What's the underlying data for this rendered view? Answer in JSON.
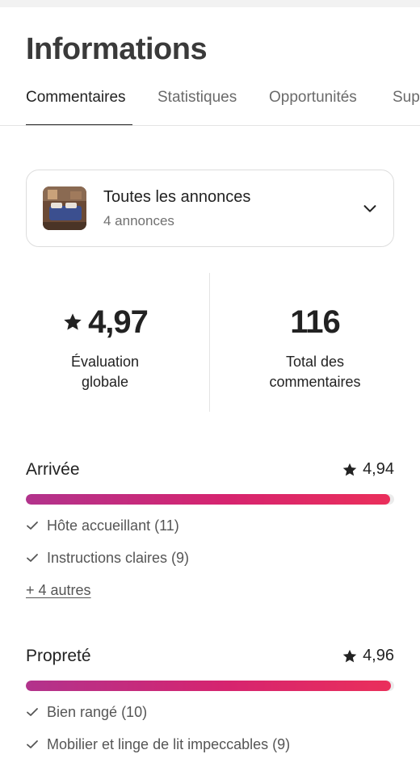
{
  "header": {
    "title": "Informations"
  },
  "tabs": [
    {
      "label": "Commentaires",
      "active": true
    },
    {
      "label": "Statistiques",
      "active": false
    },
    {
      "label": "Opportunités",
      "active": false
    },
    {
      "label": "Sup",
      "active": false
    }
  ],
  "listing": {
    "title": "Toutes les annonces",
    "subtitle": "4 annonces",
    "icon": "chevron-down-icon"
  },
  "summary": {
    "rating": {
      "value": "4,97",
      "label_line1": "Évaluation",
      "label_line2": "globale"
    },
    "reviews": {
      "value": "116",
      "label_line1": "Total des",
      "label_line2": "commentaires"
    }
  },
  "categories": [
    {
      "title": "Arrivée",
      "rating": "4,94",
      "level": 0.988,
      "items": [
        "Hôte accueillant (11)",
        "Instructions claires (9)"
      ],
      "more": "+ 4 autres"
    },
    {
      "title": "Propreté",
      "rating": "4,96",
      "level": 0.992,
      "items": [
        "Bien rangé (10)",
        "Mobilier et linge de lit impeccables (9)"
      ]
    }
  ],
  "colors": {
    "accent_start": "#b2338c",
    "accent_end": "#ea2f5b",
    "text": "#222222",
    "muted": "#717171"
  }
}
